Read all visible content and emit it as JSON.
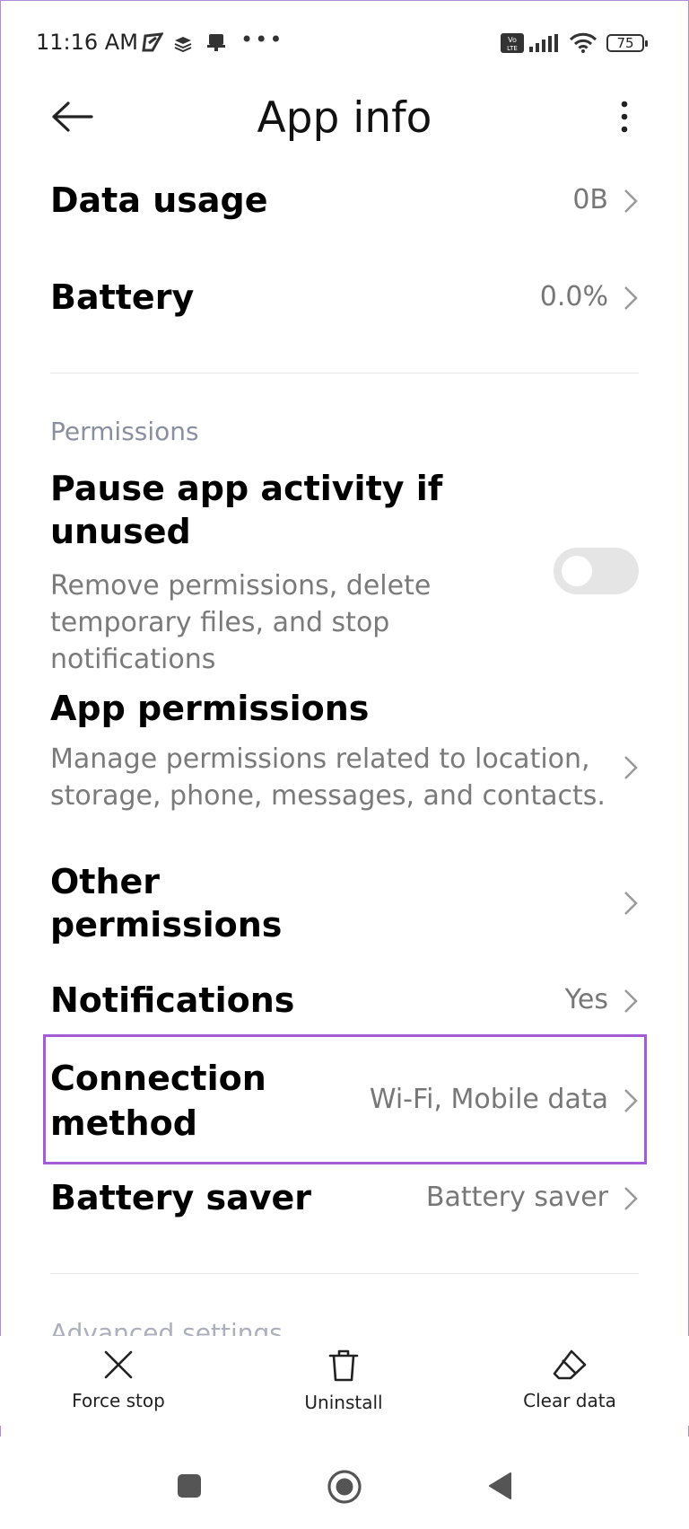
{
  "status_bar": {
    "time": "11:16 AM",
    "battery_level": "75",
    "icons": [
      "send-icon",
      "layers-icon",
      "notification-icon",
      "volte-icon",
      "signal-icon",
      "wifi-icon",
      "battery-icon"
    ]
  },
  "header": {
    "title": "App info"
  },
  "rows": {
    "data_usage": {
      "label": "Data usage",
      "value": "0B"
    },
    "battery": {
      "label": "Battery",
      "value": "0.0%"
    }
  },
  "permissions": {
    "section_title": "Permissions",
    "pause_activity": {
      "label": "Pause app activity if unused",
      "description": "Remove permissions, delete temporary files, and stop notifications",
      "toggle_on": false
    },
    "app_permissions": {
      "label": "App permissions",
      "description": "Manage permissions related to location, storage, phone, messages, and contacts."
    },
    "other_permissions": {
      "label": "Other permissions"
    },
    "notifications": {
      "label": "Notifications",
      "value": "Yes"
    },
    "connection_method": {
      "label": "Connection method",
      "value": "Wi-Fi, Mobile data"
    },
    "battery_saver": {
      "label": "Battery saver",
      "value": "Battery saver"
    }
  },
  "advanced_section_title": "Advanced settings",
  "actions": {
    "force_stop": "Force stop",
    "uninstall": "Uninstall",
    "clear_data": "Clear data"
  },
  "colors": {
    "highlight": "#a35bd6",
    "secondary_text": "#777777",
    "section_text": "#8a8fa0"
  }
}
